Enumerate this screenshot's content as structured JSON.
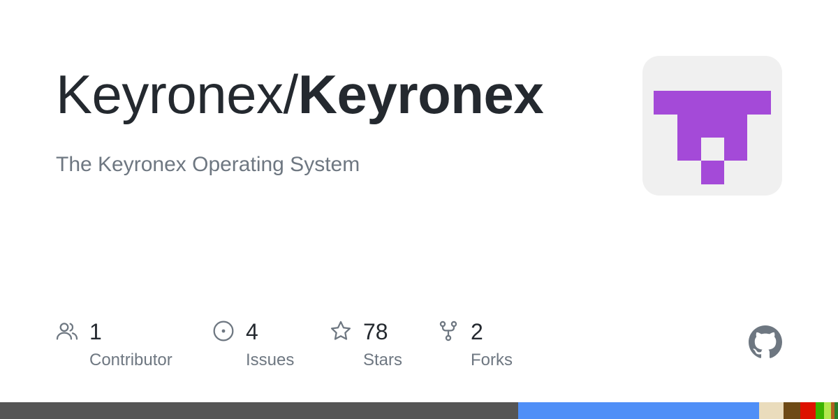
{
  "repo": {
    "owner": "Keyronex/",
    "name": "Keyronex",
    "description": "The Keyronex Operating System"
  },
  "avatar": {
    "background": "#f0f0f0",
    "logo_color": "#a44ad8"
  },
  "stats": [
    {
      "icon": "people-icon",
      "value": "1",
      "label": "Contributor"
    },
    {
      "icon": "issue-icon",
      "value": "4",
      "label": "Issues"
    },
    {
      "icon": "star-icon",
      "value": "78",
      "label": "Stars"
    },
    {
      "icon": "fork-icon",
      "value": "2",
      "label": "Forks"
    }
  ],
  "github_logo": {
    "icon": "github-icon",
    "color": "#6e7781"
  },
  "languages": [
    {
      "color": "#555555",
      "percent": 61.8
    },
    {
      "color": "#4f8ff7",
      "percent": 28.8
    },
    {
      "color": "#eadcbc",
      "percent": 2.9
    },
    {
      "color": "#6e4a16",
      "percent": 2.0
    },
    {
      "color": "#dd1100",
      "percent": 1.8
    },
    {
      "color": "#3bb300",
      "percent": 1.0
    },
    {
      "color": "#b2e84e",
      "percent": 0.9
    },
    {
      "color": "#b15e22",
      "percent": 0.4
    },
    {
      "color": "#2a7d2a",
      "percent": 0.4
    }
  ]
}
